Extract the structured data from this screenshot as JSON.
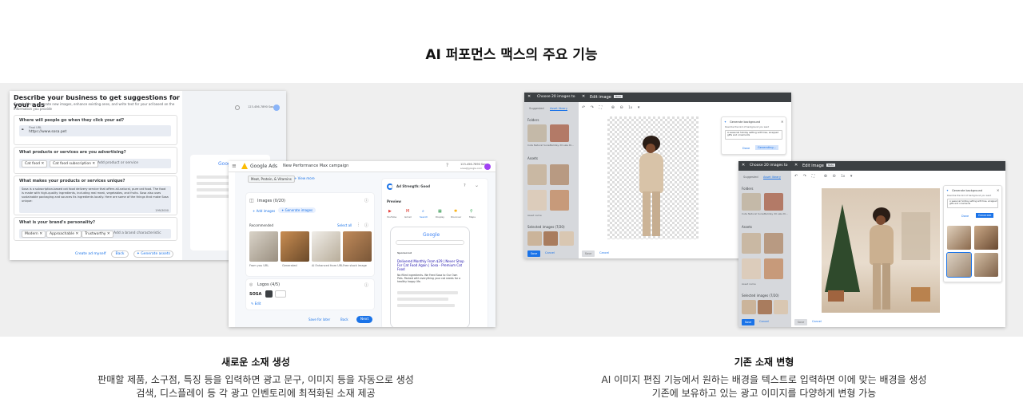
{
  "page": {
    "title": "AI 퍼포먼스 맥스의 주요 기능"
  },
  "left_panel": {
    "caption_title": "새로운 소재 생성",
    "caption_lines": [
      "판매할 제품, 소구점, 특징 등을 입력하면 광고 문구, 이미지 등을 자동으로 생성",
      "검색, 디스플레이 등 각 광고 인벤토리에 최적화된 소재 제공"
    ],
    "describe": {
      "heading": "Describe your business to get suggestions for your ads",
      "subtext": "Google AI can generate new images, enhance existing ones, and write text for your ad based on the information you provide",
      "q1": "Where will people go when they click your ad?",
      "url_label": "Final URL",
      "url_value": "https://www.sosa.pet",
      "q2": "What products or services are you advertising?",
      "chips2": [
        "Cat food",
        "Cat food subscription"
      ],
      "add_product": "Add product or service",
      "q3": "What makes your products or services unique?",
      "unique_text": "Sosa is a subscription-based cat food delivery service that offers all-natural, pure cat food. The food is made with high-quality ingredients, including real meat, vegetables, and fruits. Sosa also uses sustainable packaging and sources its ingredients locally. Here are some of the things that make Sosa unique:",
      "counter": "199/3000",
      "q4": "What is your brand's personality?",
      "chips4": [
        "Modern",
        "Approachable",
        "Trustworthy"
      ],
      "add_brand": "Add a brand characteristic",
      "create_link": "Create ad myself",
      "back": "Back",
      "generate": "Generate assets",
      "account": "123-456-7890 Sosa"
    },
    "ads": {
      "brand": "Google Ads",
      "campaign": "New Performance Max campaign",
      "account": "123-456-7890 Sosa",
      "account_email": "sosa@google.com",
      "audience_chip": "Meat, Protein, & Vitamins",
      "view_more": "View more",
      "images_label": "Images (0/20)",
      "add_images": "Add images",
      "generate_images": "Generate images",
      "recommended": "Recommended",
      "select_all": "Select all",
      "thumb_labels": [
        "From you URL",
        "Generated",
        "AI Enhanced from URL",
        "Free stock image"
      ],
      "logos_label": "Logos (4/5)",
      "logo_text": "SOSA",
      "edit": "Edit",
      "ad_strength": "Ad Strength: Good",
      "preview": "Preview",
      "channels": [
        "YouTube",
        "Gmail",
        "Search",
        "Display",
        "Discover",
        "Maps"
      ],
      "google_word": "Google",
      "sponsored": "Sponsored",
      "ad_title": "Delivered Monthly From $29 | Never Shop For Cat Food Again | Sosa - Premium Cat Food",
      "ad_desc": "No filled ingredients. We Feed Sosa to Our Own Pets. Packed with everything your cat needs for a healthy happy life.",
      "save_later": "Save for later",
      "back": "Back",
      "next": "Next"
    }
  },
  "right_panel": {
    "caption_title": "기존 소재 변형",
    "caption_lines": [
      "AI 이미지 편집 기능에서 원하는 배경을 텍스트로 입력하면 이에 맞는 배경을 생성",
      "기존에 보유하고 있는 광고 이미지를 다양하게 변형 가능"
    ],
    "editor": {
      "choose_title": "Choose 20 images to",
      "edit_title": "Edit image",
      "beta": "Beta",
      "tabs": [
        "Suggested",
        "Asset library"
      ],
      "folders": "Folders",
      "assets": "Assets",
      "selected": "Selected images (7/20)",
      "folder_labels": [
        "Cute Natural Sunsc...",
        "Holiday 20 sale Di..."
      ],
      "asset_label": "Asset name",
      "popup_title": "Generate background",
      "popup_hint": "Describe the kind of background you want",
      "popup_text": "A seasonal holiday setting with tree, wrapped gifts and ornaments",
      "done": "Done",
      "generating": "Generating...",
      "generate": "Generate",
      "save": "Save",
      "cancel": "Cancel",
      "zoom": "1x"
    }
  },
  "colors": {
    "accent": "#1a73e8",
    "band": "#efefef",
    "editor_header": "#3c4043"
  }
}
